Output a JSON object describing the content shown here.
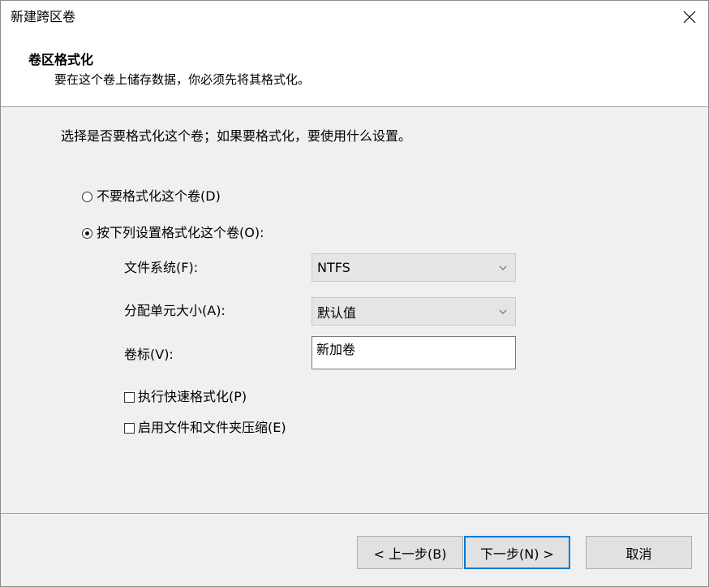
{
  "window": {
    "title": "新建跨区卷"
  },
  "header": {
    "title": "卷区格式化",
    "subtitle": "要在这个卷上储存数据，你必须先将其格式化。"
  },
  "main": {
    "instruction": "选择是否要格式化这个卷；如果要格式化，要使用什么设置。",
    "options": [
      {
        "label": "不要格式化这个卷(D)",
        "selected": false
      },
      {
        "label": "按下列设置格式化这个卷(O):",
        "selected": true
      }
    ],
    "file_system": {
      "label": "文件系统(F):",
      "value": "NTFS"
    },
    "allocation_unit": {
      "label": "分配单元大小(A):",
      "value": "默认值"
    },
    "volume_label": {
      "label": "卷标(V):",
      "value": "新加卷"
    },
    "checkboxes": [
      {
        "label": "执行快速格式化(P)",
        "checked": false
      },
      {
        "label": "启用文件和文件夹压缩(E)",
        "checked": false
      }
    ]
  },
  "buttons": {
    "back": "< 上一步(B)",
    "next": "下一步(N) >",
    "cancel": "取消"
  },
  "icons": {
    "close": "close-icon",
    "dropdown": "chevron-down-icon"
  },
  "colors": {
    "accent": "#0078d7",
    "dialog_background": "#f0f0f0"
  }
}
